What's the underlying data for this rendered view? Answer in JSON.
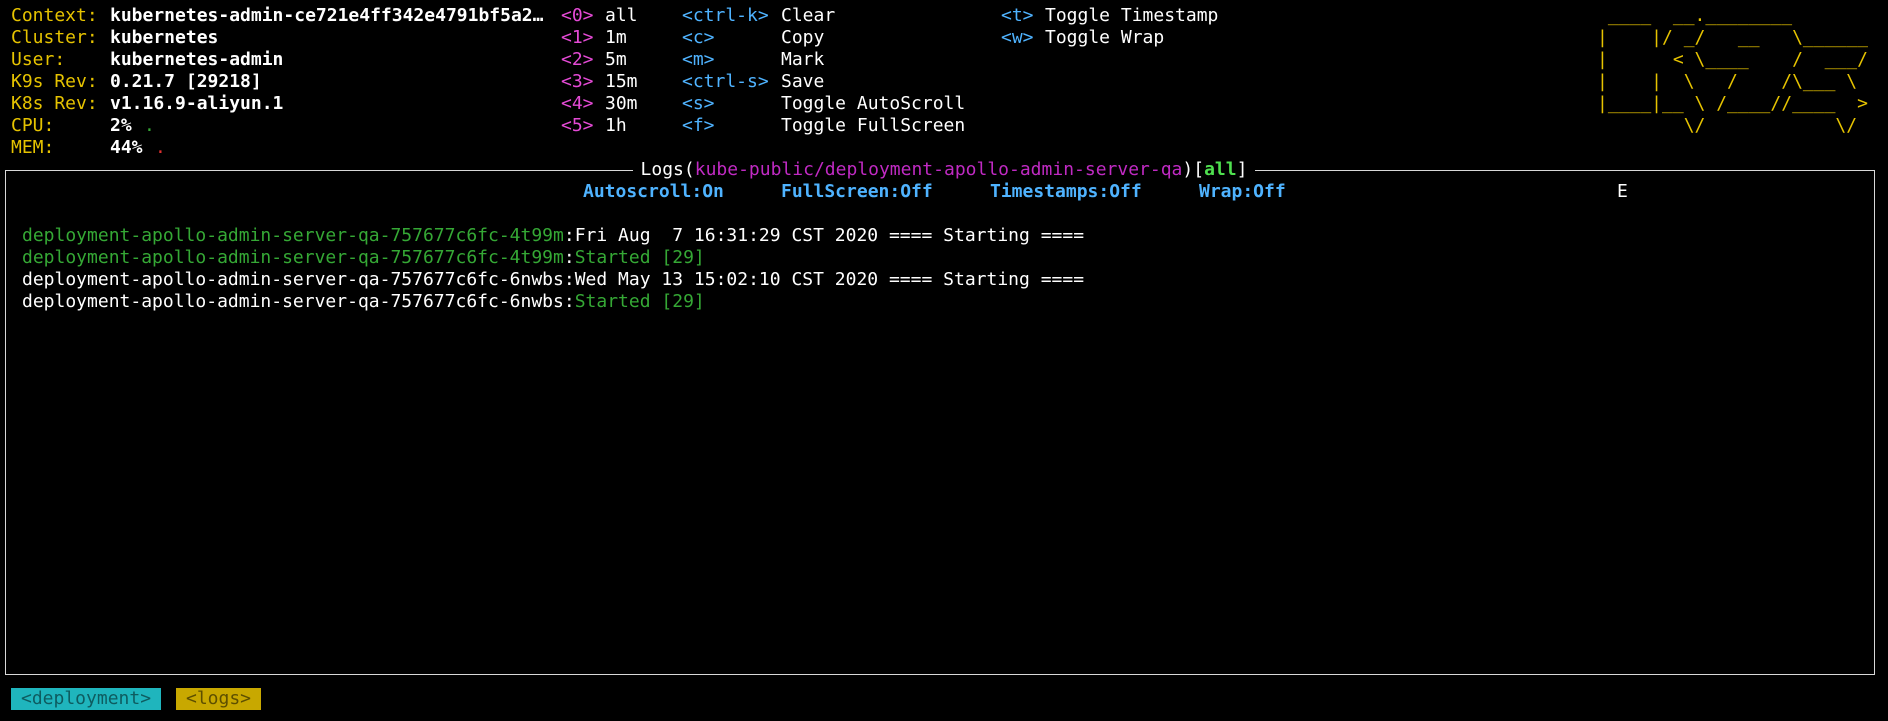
{
  "header": {
    "info": [
      {
        "label": "Context:",
        "value": "kubernetes-admin-ce721e4ff342e4791bf5a2…"
      },
      {
        "label": "Cluster:",
        "value": "kubernetes"
      },
      {
        "label": "User:",
        "value": "kubernetes-admin"
      },
      {
        "label": "K9s Rev:",
        "value": "0.21.7 [29218]"
      },
      {
        "label": "K8s Rev:",
        "value": "v1.16.9-aliyun.1"
      },
      {
        "label": "CPU:",
        "value": "2%",
        "dot": "."
      },
      {
        "label": "MEM:",
        "value": "44%",
        "dot": "."
      }
    ],
    "time_keys": [
      {
        "key": "<0>",
        "label": "all"
      },
      {
        "key": "<1>",
        "label": "1m"
      },
      {
        "key": "<2>",
        "label": "5m"
      },
      {
        "key": "<3>",
        "label": "15m"
      },
      {
        "key": "<4>",
        "label": "30m"
      },
      {
        "key": "<5>",
        "label": "1h"
      }
    ],
    "action_keys": [
      {
        "key": "<ctrl-k>",
        "label": "Clear"
      },
      {
        "key": "<c>",
        "label": "Copy"
      },
      {
        "key": "<m>",
        "label": "Mark"
      },
      {
        "key": "<ctrl-s>",
        "label": "Save"
      },
      {
        "key": "<s>",
        "label": "Toggle AutoScroll"
      },
      {
        "key": "<f>",
        "label": "Toggle FullScreen"
      }
    ],
    "toggle_keys": [
      {
        "key": "<t>",
        "label": "Toggle Timestamp"
      },
      {
        "key": "<w>",
        "label": "Toggle Wrap"
      }
    ],
    "logo_lines": [
      " ____  __.________       ",
      "|    |/ _/   __   \\______",
      "|      < \\____    /  ___/",
      "|    |  \\   /    /\\___ \\ ",
      "|____|__ \\ /____//____  >",
      "        \\/            \\/ "
    ]
  },
  "logs_panel": {
    "title_prefix": "Logs(",
    "namespace_path": "kube-public/deployment-apollo-admin-server-qa",
    "title_close": ")[",
    "filter": "all",
    "title_end": "]",
    "status": {
      "autoscroll": "Autoscroll:On",
      "fullscreen": "FullScreen:Off",
      "timestamps": "Timestamps:Off",
      "wrap": "Wrap:Off",
      "extra": "E"
    },
    "lines": [
      {
        "pod": "deployment-apollo-admin-server-qa-757677c6fc-4t99m",
        "message": "Fri Aug  7 16:31:29 CST 2020 ==== Starting ===="
      },
      {
        "pod": "deployment-apollo-admin-server-qa-757677c6fc-4t99m",
        "message": "Started [29]"
      },
      {
        "pod": "deployment-apollo-admin-server-qa-757677c6fc-6nwbs",
        "message": "Wed May 13 15:02:10 CST 2020 ==== Starting ===="
      },
      {
        "pod": "deployment-apollo-admin-server-qa-757677c6fc-6nwbs",
        "message": "Started [29]"
      }
    ]
  },
  "breadcrumbs": [
    "<deployment>",
    "<logs>"
  ],
  "colors": {
    "label_yellow": "#e6c300",
    "key_pink": "#e54ad6",
    "key_blue": "#4fb3ff",
    "namespace_magenta": "#c02ac3",
    "log_green": "#35a835",
    "crumb_cyan": "#1fb5bd",
    "crumb_yellow": "#c8a800"
  }
}
